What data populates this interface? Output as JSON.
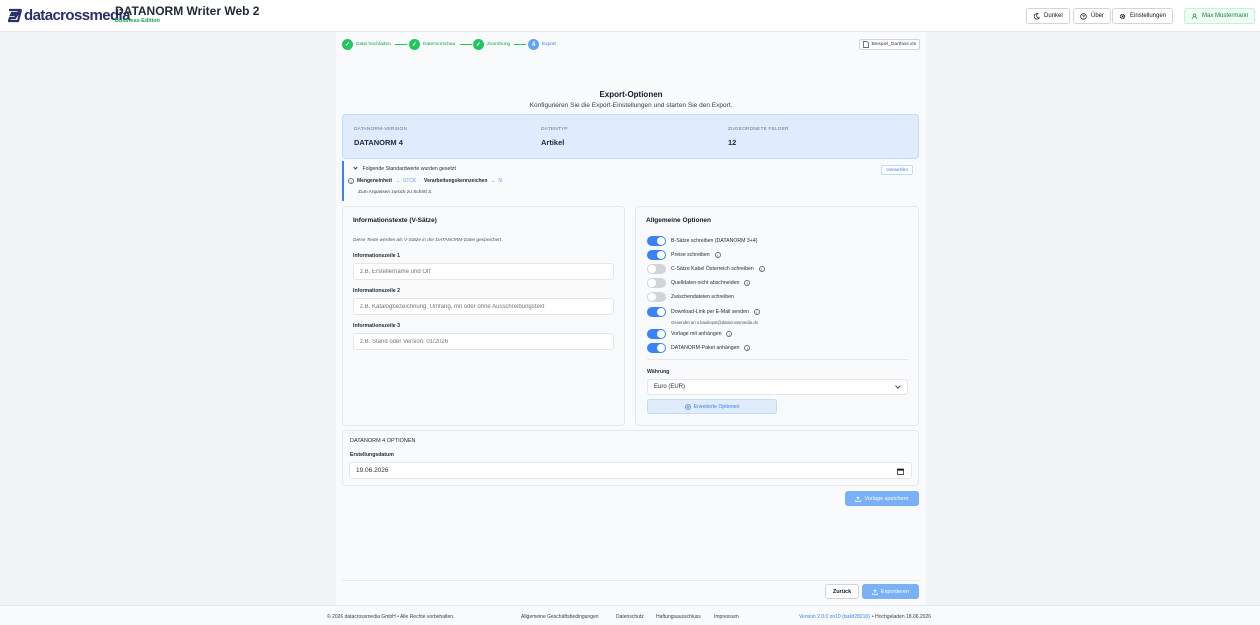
{
  "header": {
    "logo_text": "datacrossmedia",
    "app_title": "DATANORM Writer Web 2",
    "edition": "Business-Edition",
    "dark_label": "Dunkel",
    "about_label": "Über",
    "settings_label": "Einstellungen",
    "user_label": "Max Mustermann"
  },
  "stepper": {
    "steps": [
      {
        "num": "",
        "label": "Datei hochladen"
      },
      {
        "num": "",
        "label": "Datenvorschau"
      },
      {
        "num": "",
        "label": "Zuordnung"
      },
      {
        "num": "4",
        "label": "Export"
      }
    ],
    "file_name": "Beispiel_Dartfass.xls"
  },
  "page": {
    "title": "Export-Optionen",
    "subtitle": "Konfigurieren Sie die Export-Einstellungen und starten Sie den Export."
  },
  "summary": {
    "version_label": "DATANORM-VERSION",
    "version_value": "DATANORM 4",
    "type_label": "DATENTYP",
    "type_value": "Artikel",
    "fields_label": "ZUGEORDNETE FELDER",
    "fields_value": "12"
  },
  "defaults": {
    "title": "Folgende Standardwerte wurden gesetzt",
    "unit_label": "Mengeneinheit",
    "unit_value": "STCK",
    "processing_label": "Verarbeitungskennzeichen",
    "processing_value": "N",
    "note": "Zum Anpassen zurück zu Schritt 3.",
    "discard_label": "Verwerfen",
    "arrow": "→"
  },
  "info_texts": {
    "title": "Informationstexte (V-Sätze)",
    "note": "Diese Texte werden als V-Sätze in der DATANORM-Datei gespeichert.",
    "fields": [
      {
        "label": "Informationszeile 1",
        "placeholder": "z.B. Erstellername und Ort"
      },
      {
        "label": "Informationszeile 2",
        "placeholder": "z.B. Katalogbezeichnung, Umfang, mit oder ohne Ausschreibungstext"
      },
      {
        "label": "Informationszeile 3",
        "placeholder": "z.B. Stand oder Version: 01/2026"
      }
    ]
  },
  "general_options": {
    "title": "Allgemeine Optionen",
    "options": [
      {
        "label": "B-Sätze schreiben (DATANORM 3+4)",
        "on": true,
        "info": false
      },
      {
        "label": "Preise schreiben",
        "on": true,
        "info": true
      },
      {
        "label": "C-Sätze Kabel Österreich schreiben",
        "on": false,
        "info": true
      },
      {
        "label": "Quelldaten nicht abschneiden",
        "on": false,
        "info": true
      },
      {
        "label": "Zwischendateien schreiben",
        "on": false,
        "info": false
      },
      {
        "label": "Download-Link per E-Mail senden",
        "on": true,
        "info": true
      },
      {
        "label": "Vorlage mit anhängen",
        "on": true,
        "info": true
      },
      {
        "label": "DATANORM-Paket anhängen",
        "on": true,
        "info": true
      }
    ],
    "email_note": "Gesendet an s.bauliepst@datacrossmedia.de",
    "currency_label": "Währung",
    "currency_value": "Euro (EUR)",
    "advanced_label": "Erweiterte Optionen"
  },
  "dn4": {
    "title": "DATANORM 4 OPTIONEN",
    "date_label": "Erstellungsdatum",
    "date_value": "19.06.2026"
  },
  "actions": {
    "save_template": "Vorlage speichern",
    "back": "Zurück",
    "export": "Exportieren"
  },
  "footer": {
    "copyright": "© 2026 datacrossmedia GmbH • Alle Rechte vorbehalten.",
    "agb": "Allgemeine Geschäftsbedingungen",
    "privacy": "Datenschutz",
    "liability": "Haftungsausschluss",
    "imprint": "Impressum",
    "version": "Version 2.0.0 on10 (build28210)",
    "uploaded": "• Hochgeladen 18.06.2026"
  },
  "colors": {
    "accent": "#3b82f6",
    "success": "#22c55e",
    "brand": "#2b2f6b"
  }
}
